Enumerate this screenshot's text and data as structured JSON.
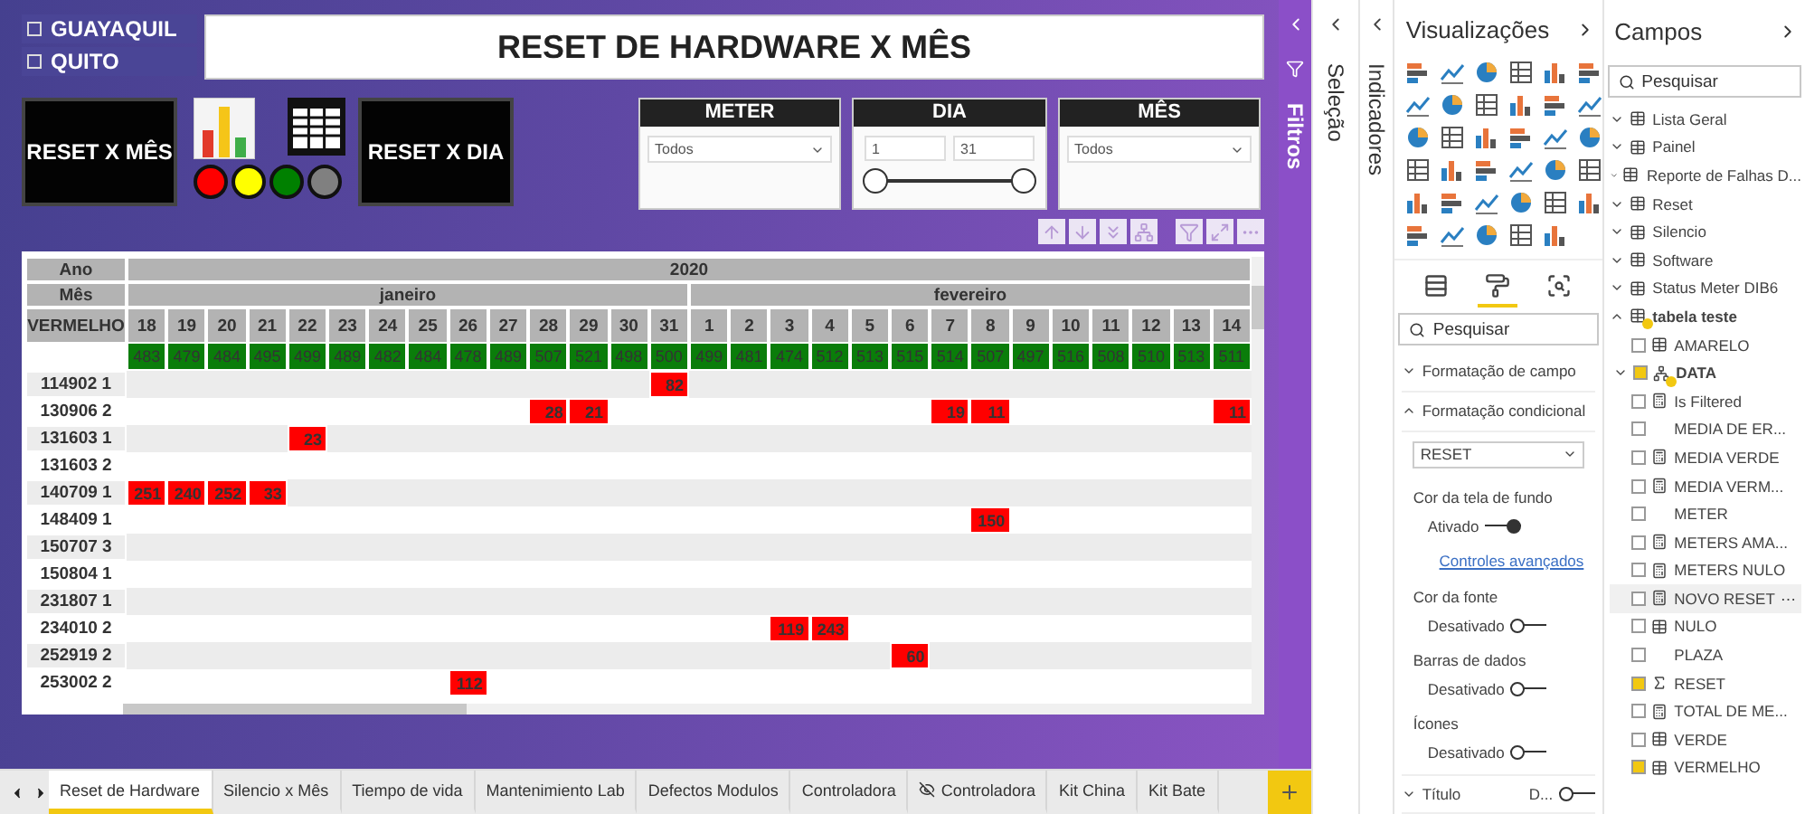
{
  "filters_pane": {
    "title": "Filtros"
  },
  "selection_pane": {
    "title": "Seleção"
  },
  "bookmarks_pane": {
    "title": "Indicadores"
  },
  "canvas": {
    "cities": [
      {
        "label": "GUAYAQUIL",
        "checked": false
      },
      {
        "label": "QUITO",
        "checked": false
      }
    ],
    "title": "RESET DE HARDWARE X MÊS",
    "left_button": "RESET X MÊS",
    "right_button": "RESET X DIA",
    "status_lights": [
      {
        "color": "#ff0000"
      },
      {
        "color": "#ffff00"
      },
      {
        "color": "#008000"
      },
      {
        "color": "#808080"
      }
    ],
    "slicers": [
      {
        "kind": "dropdown",
        "title": "METER",
        "value": "Todos"
      },
      {
        "kind": "range",
        "title": "DIA",
        "from": "1",
        "to": "31",
        "level": 1
      },
      {
        "kind": "dropdown",
        "title": "MÊS",
        "value": "Todos"
      }
    ],
    "matrix": {
      "year_label": "Ano",
      "year": "2020",
      "month_label": "Mês",
      "row_label": "VERMELHO",
      "months": [
        {
          "name": "janeiro",
          "days": [
            "18",
            "19",
            "20",
            "21",
            "22",
            "23",
            "24",
            "25",
            "26",
            "27",
            "28",
            "29",
            "30",
            "31"
          ]
        },
        {
          "name": "fevereiro",
          "days": [
            "1",
            "2",
            "3",
            "4",
            "5",
            "6",
            "7",
            "8",
            "9",
            "10",
            "11",
            "12",
            "13",
            "14"
          ]
        }
      ],
      "totals": [
        "483",
        "479",
        "484",
        "495",
        "499",
        "489",
        "482",
        "484",
        "478",
        "489",
        "507",
        "521",
        "498",
        "500",
        "499",
        "481",
        "474",
        "512",
        "513",
        "515",
        "514",
        "507",
        "497",
        "516",
        "508",
        "510",
        "513",
        "511"
      ],
      "rows": [
        {
          "meter": "114902 1",
          "cells": [
            null,
            null,
            null,
            null,
            null,
            null,
            null,
            null,
            null,
            null,
            null,
            null,
            null,
            "82",
            null,
            null,
            null,
            null,
            null,
            null,
            null,
            null,
            null,
            null,
            null,
            null,
            null,
            null
          ]
        },
        {
          "meter": "130906 2",
          "cells": [
            null,
            null,
            null,
            null,
            null,
            null,
            null,
            null,
            null,
            null,
            "28",
            "21",
            null,
            null,
            null,
            null,
            null,
            null,
            null,
            null,
            "19",
            "11",
            null,
            null,
            null,
            null,
            null,
            "11"
          ]
        },
        {
          "meter": "131603 1",
          "cells": [
            null,
            null,
            null,
            null,
            "23",
            null,
            null,
            null,
            null,
            null,
            null,
            null,
            null,
            null,
            null,
            null,
            null,
            null,
            null,
            null,
            null,
            null,
            null,
            null,
            null,
            null,
            null,
            null
          ]
        },
        {
          "meter": "131603 2",
          "cells": [
            null,
            null,
            null,
            null,
            null,
            null,
            null,
            null,
            null,
            null,
            null,
            null,
            null,
            null,
            null,
            null,
            null,
            null,
            null,
            null,
            null,
            null,
            null,
            null,
            null,
            null,
            null,
            null
          ]
        },
        {
          "meter": "140709 1",
          "cells": [
            "251",
            "240",
            "252",
            "33",
            null,
            null,
            null,
            null,
            null,
            null,
            null,
            null,
            null,
            null,
            null,
            null,
            null,
            null,
            null,
            null,
            null,
            null,
            null,
            null,
            null,
            null,
            null,
            null
          ]
        },
        {
          "meter": "148409 1",
          "cells": [
            null,
            null,
            null,
            null,
            null,
            null,
            null,
            null,
            null,
            null,
            null,
            null,
            null,
            null,
            null,
            null,
            null,
            null,
            null,
            null,
            null,
            "150",
            null,
            null,
            null,
            null,
            null,
            null
          ]
        },
        {
          "meter": "150707 3",
          "cells": [
            null,
            null,
            null,
            null,
            null,
            null,
            null,
            null,
            null,
            null,
            null,
            null,
            null,
            null,
            null,
            null,
            null,
            null,
            null,
            null,
            null,
            null,
            null,
            null,
            null,
            null,
            null,
            null
          ]
        },
        {
          "meter": "150804 1",
          "cells": [
            null,
            null,
            null,
            null,
            null,
            null,
            null,
            null,
            null,
            null,
            null,
            null,
            null,
            null,
            null,
            null,
            null,
            null,
            null,
            null,
            null,
            null,
            null,
            null,
            null,
            null,
            null,
            null
          ]
        },
        {
          "meter": "231807 1",
          "cells": [
            null,
            null,
            null,
            null,
            null,
            null,
            null,
            null,
            null,
            null,
            null,
            null,
            null,
            null,
            null,
            null,
            null,
            null,
            null,
            null,
            null,
            null,
            null,
            null,
            null,
            null,
            null,
            null
          ]
        },
        {
          "meter": "234010 2",
          "cells": [
            null,
            null,
            null,
            null,
            null,
            null,
            null,
            null,
            null,
            null,
            null,
            null,
            null,
            null,
            null,
            null,
            "119",
            "243",
            null,
            null,
            null,
            null,
            null,
            null,
            null,
            null,
            null,
            null
          ]
        },
        {
          "meter": "252919 2",
          "cells": [
            null,
            null,
            null,
            null,
            null,
            null,
            null,
            null,
            null,
            null,
            null,
            null,
            null,
            null,
            null,
            null,
            null,
            null,
            null,
            "60",
            null,
            null,
            null,
            null,
            null,
            null,
            null,
            null
          ]
        },
        {
          "meter": "253002 2",
          "cells": [
            null,
            null,
            null,
            null,
            null,
            null,
            null,
            null,
            "112",
            null,
            null,
            null,
            null,
            null,
            null,
            null,
            null,
            null,
            null,
            null,
            null,
            null,
            null,
            null,
            null,
            null,
            null,
            null
          ]
        }
      ]
    }
  },
  "page_tabs": [
    {
      "label": "Reset de Hardware",
      "selected": true,
      "hidden": false
    },
    {
      "label": "Silencio x Mês",
      "selected": false,
      "hidden": false
    },
    {
      "label": "Tiempo de vida",
      "selected": false,
      "hidden": false
    },
    {
      "label": "Mantenimiento Lab",
      "selected": false,
      "hidden": false
    },
    {
      "label": "Defectos Modulos",
      "selected": false,
      "hidden": false
    },
    {
      "label": "Controladora",
      "selected": false,
      "hidden": false
    },
    {
      "label": "Controladora",
      "selected": false,
      "hidden": true
    },
    {
      "label": "Kit China",
      "selected": false,
      "hidden": false
    },
    {
      "label": "Kit Bate",
      "selected": false,
      "hidden": false
    }
  ],
  "visualizations": {
    "title": "Visualizações",
    "format_tabs": [
      {
        "kind": "fields",
        "selected": false
      },
      {
        "kind": "format",
        "selected": true
      },
      {
        "kind": "analytics",
        "selected": false
      }
    ],
    "search": {
      "placeholder": "Pesquisar"
    },
    "sections": [
      {
        "kind": "header",
        "label": "Formatação de campo",
        "expanded": false
      },
      {
        "kind": "header",
        "label": "Formatação condicional",
        "expanded": true
      },
      {
        "kind": "dropdown",
        "label": "RESET"
      },
      {
        "kind": "label",
        "label": "Cor da tela de fundo"
      },
      {
        "kind": "toggle",
        "label": "Ativado",
        "on": true
      },
      {
        "kind": "link",
        "label": "Controles avançados"
      },
      {
        "kind": "label",
        "label": "Cor da fonte"
      },
      {
        "kind": "toggle",
        "label": "Desativado",
        "on": false
      },
      {
        "kind": "label",
        "label": "Barras de dados"
      },
      {
        "kind": "toggle",
        "label": "Desativado",
        "on": false
      },
      {
        "kind": "label",
        "label": "Ícones"
      },
      {
        "kind": "toggle",
        "label": "Desativado",
        "on": false
      },
      {
        "kind": "title",
        "label": "Título",
        "value": "D...",
        "expanded": false,
        "on": false
      }
    ]
  },
  "fields": {
    "title": "Campos",
    "search": {
      "placeholder": "Pesquisar"
    },
    "tables": [
      {
        "name": "Lista Geral",
        "expanded": false,
        "in_use": false
      },
      {
        "name": "Painel",
        "expanded": false,
        "in_use": false
      },
      {
        "name": "Reporte de Falhas D...",
        "expanded": false,
        "in_use": false
      },
      {
        "name": "Reset",
        "expanded": false,
        "in_use": false
      },
      {
        "name": "Silencio",
        "expanded": false,
        "in_use": false
      },
      {
        "name": "Software",
        "expanded": false,
        "in_use": false
      },
      {
        "name": "Status Meter DIB6",
        "expanded": false,
        "in_use": false
      },
      {
        "name": "tabela teste",
        "expanded": true,
        "in_use": true,
        "fields": [
          {
            "name": "AMARELO",
            "kind": "column",
            "checked": false,
            "hovered": false
          },
          {
            "name": "DATA",
            "kind": "hierarchy",
            "checked": true,
            "hovered": false
          },
          {
            "name": "Is Filtered",
            "kind": "measure",
            "checked": false,
            "hovered": false
          },
          {
            "name": "MEDIA DE ER...",
            "kind": "plain",
            "checked": false,
            "hovered": false
          },
          {
            "name": "MEDIA VERDE",
            "kind": "measure",
            "checked": false,
            "hovered": false
          },
          {
            "name": "MEDIA VERM...",
            "kind": "measure",
            "checked": false,
            "hovered": false
          },
          {
            "name": "METER",
            "kind": "plain",
            "checked": false,
            "hovered": false
          },
          {
            "name": "METERS AMA...",
            "kind": "measure",
            "checked": false,
            "hovered": false
          },
          {
            "name": "METERS NULO",
            "kind": "measure",
            "checked": false,
            "hovered": false
          },
          {
            "name": "NOVO RESET",
            "kind": "measure",
            "checked": false,
            "hovered": true,
            "more": "⋯"
          },
          {
            "name": "NULO",
            "kind": "column",
            "checked": false,
            "hovered": false
          },
          {
            "name": "PLAZA",
            "kind": "plain",
            "checked": false,
            "hovered": false
          },
          {
            "name": "RESET",
            "kind": "sum",
            "checked": true,
            "hovered": false
          },
          {
            "name": "TOTAL DE ME...",
            "kind": "measure",
            "checked": false,
            "hovered": false
          },
          {
            "name": "VERDE",
            "kind": "column",
            "checked": false,
            "hovered": false
          },
          {
            "name": "VERMELHO",
            "kind": "column",
            "checked": true,
            "hovered": false
          }
        ]
      }
    ]
  }
}
